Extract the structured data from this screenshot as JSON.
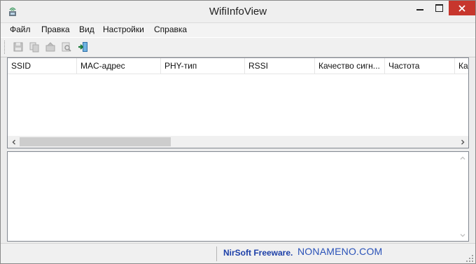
{
  "window": {
    "title": "WifiInfoView",
    "controls": {
      "minimize": "minimize",
      "maximize": "maximize",
      "close": "close"
    }
  },
  "menu": {
    "items": [
      "Файл",
      "Правка",
      "Вид",
      "Настройки",
      "Справка"
    ]
  },
  "toolbar": {
    "tools": [
      {
        "icon": "save-icon",
        "enabled": false
      },
      {
        "icon": "copy-icon",
        "enabled": false
      },
      {
        "icon": "properties-icon",
        "enabled": false
      },
      {
        "icon": "find-icon",
        "enabled": false
      },
      {
        "icon": "exit-icon",
        "enabled": true
      }
    ]
  },
  "list": {
    "columns": [
      "SSID",
      "MAC-адрес",
      "PHY-тип",
      "RSSI",
      "Качество сигн...",
      "Частота",
      "Кан"
    ],
    "rows": []
  },
  "statusbar": {
    "credit": "NirSoft Freeware.",
    "watermark": "NONAMENO.COM"
  },
  "colors": {
    "close_button": "#c7362d",
    "credit_text": "#1c3fa8",
    "watermark_text": "#2a52b8"
  }
}
